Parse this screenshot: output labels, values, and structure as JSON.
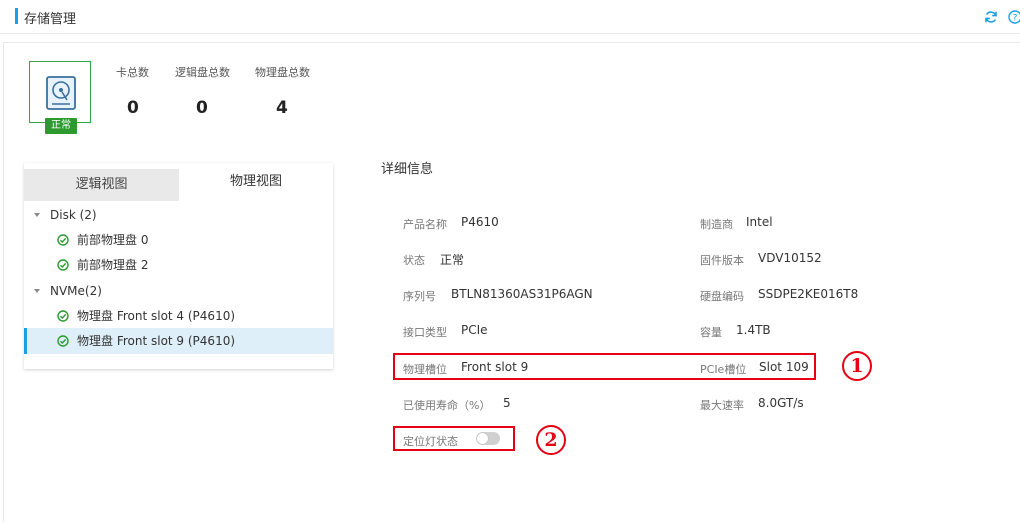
{
  "header": {
    "title": "存储管理"
  },
  "icons": {
    "refresh": "refresh-icon",
    "help": "help-icon",
    "disk": "hard-disk-icon",
    "status_ok": "check-circle-icon"
  },
  "colors": {
    "accent": "#1aa0e8",
    "ok": "#39a33a",
    "annotation": "#e60012"
  },
  "summary": {
    "status_badge": "正常",
    "stats": [
      {
        "label": "卡总数",
        "value": "0"
      },
      {
        "label": "逻辑盘总数",
        "value": "0"
      },
      {
        "label": "物理盘总数",
        "value": "4"
      }
    ]
  },
  "tree": {
    "tabs": [
      "逻辑视图",
      "物理视图"
    ],
    "active_tab": "物理视图",
    "groups": [
      {
        "label": "Disk (2)",
        "items": [
          "前部物理盘 0",
          "前部物理盘 2"
        ]
      },
      {
        "label": "NVMe(2)",
        "items": [
          "物理盘 Front slot 4 (P4610)",
          "物理盘 Front slot 9 (P4610)"
        ]
      }
    ],
    "selected": "物理盘 Front slot 9 (P4610)"
  },
  "details": {
    "title": "详细信息",
    "left": [
      {
        "label": "产品名称",
        "value": "P4610"
      },
      {
        "label": "状态",
        "value": "正常"
      },
      {
        "label": "序列号",
        "value": "BTLN81360AS31P6AGN"
      },
      {
        "label": "接口类型",
        "value": "PCIe"
      },
      {
        "label": "物理槽位",
        "value": "Front slot 9"
      },
      {
        "label": "已使用寿命（%）",
        "value": "5"
      }
    ],
    "right": [
      {
        "label": "制造商",
        "value": "Intel"
      },
      {
        "label": "固件版本",
        "value": "VDV10152"
      },
      {
        "label": "硬盘编码",
        "value": "SSDPE2KE016T8"
      },
      {
        "label": "容量",
        "value": "1.4TB"
      },
      {
        "label": "PCIe槽位",
        "value": "Slot 109"
      },
      {
        "label": "最大速率",
        "value": "8.0GT/s"
      }
    ],
    "locate_led": {
      "label": "定位灯状态",
      "on": false
    }
  },
  "annotations": [
    "1",
    "2"
  ]
}
